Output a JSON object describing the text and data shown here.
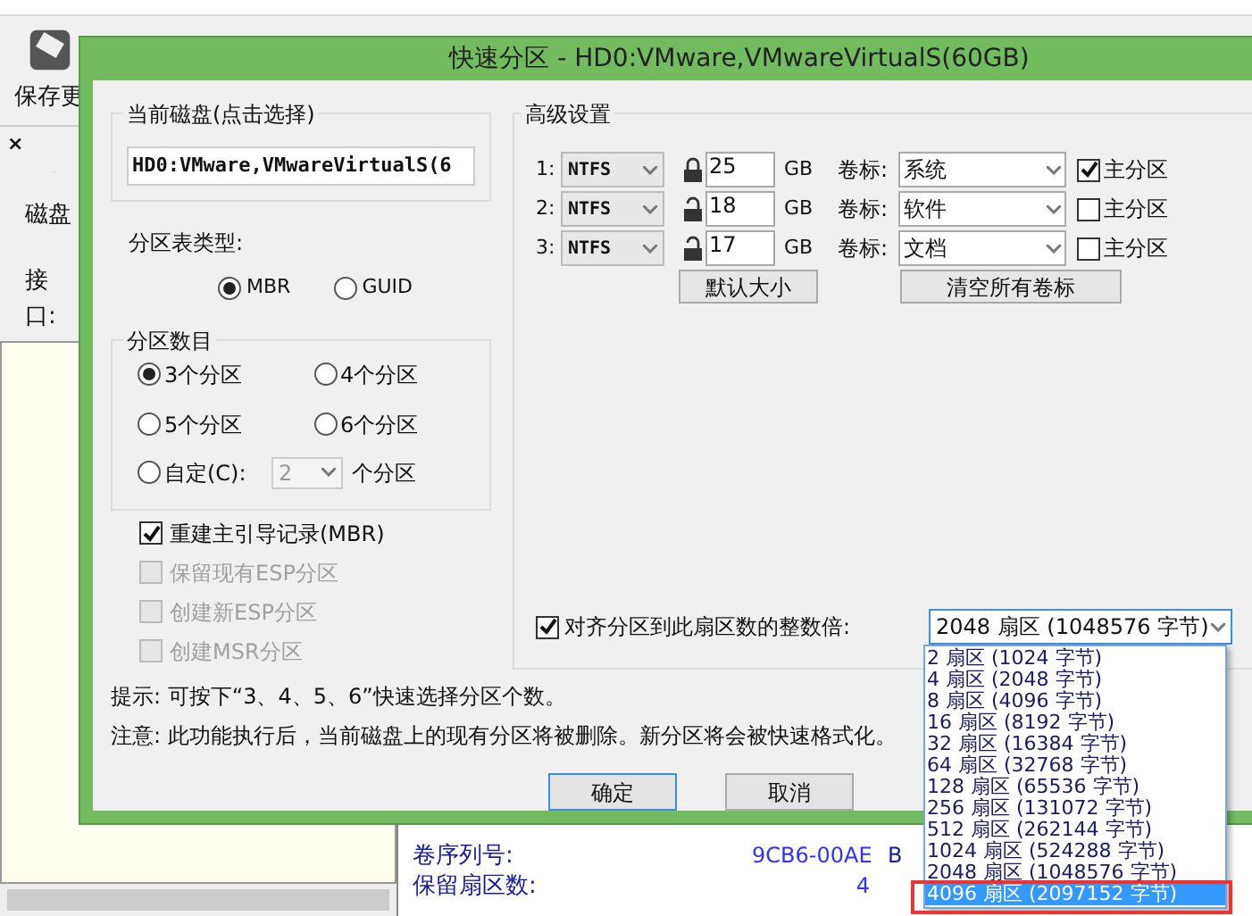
{
  "app": {
    "close": "×",
    "toolbar": [
      "保存更"
    ],
    "side_labels": [
      "磁盘",
      "接口:"
    ],
    "info": [
      {
        "label": "卷序列号:",
        "value": "9CB6-00AE",
        "extra": "B"
      },
      {
        "label": "保留扇区数:",
        "value": "4"
      }
    ]
  },
  "dialog": {
    "title": "快速分区 - HD0:VMware,VMwareVirtualS(60GB)",
    "disk_group": {
      "title": "当前磁盘(点击选择)",
      "value": "HD0:VMware,VMwareVirtualS(6"
    },
    "table_type": {
      "label": "分区表类型:",
      "options": [
        {
          "label": "MBR",
          "selected": true
        },
        {
          "label": "GUID",
          "selected": false
        }
      ]
    },
    "count_group": {
      "title": "分区数目",
      "options": [
        {
          "label": "3个分区",
          "selected": true
        },
        {
          "label": "4个分区",
          "selected": false
        },
        {
          "label": "5个分区",
          "selected": false
        },
        {
          "label": "6个分区",
          "selected": false
        }
      ],
      "custom": {
        "label": "自定(C):",
        "selected": false,
        "value": "2",
        "disabled": true,
        "suffix": "个分区"
      }
    },
    "checks": [
      {
        "label": "重建主引导记录(MBR)",
        "checked": true,
        "disabled": false
      },
      {
        "label": "保留现有ESP分区",
        "checked": false,
        "disabled": true
      },
      {
        "label": "创建新ESP分区",
        "checked": false,
        "disabled": true
      },
      {
        "label": "创建MSR分区",
        "checked": false,
        "disabled": true
      }
    ],
    "advanced": {
      "title": "高级设置",
      "rows": [
        {
          "index": "1:",
          "fs": "NTFS",
          "locked": true,
          "size": "25",
          "unit": "GB",
          "label_caption": "卷标:",
          "volume": "系统",
          "primary_label": "主分区",
          "primary": true
        },
        {
          "index": "2:",
          "fs": "NTFS",
          "locked": false,
          "size": "18",
          "unit": "GB",
          "label_caption": "卷标:",
          "volume": "软件",
          "primary_label": "主分区",
          "primary": false
        },
        {
          "index": "3:",
          "fs": "NTFS",
          "locked": false,
          "size": "17",
          "unit": "GB",
          "label_caption": "卷标:",
          "volume": "文档",
          "primary_label": "主分区",
          "primary": false
        }
      ],
      "buttons": [
        "默认大小",
        "清空所有卷标"
      ],
      "align": {
        "label": "对齐分区到此扇区数的整数倍:",
        "checked": true,
        "value": "2048 扇区 (1048576 字节)",
        "options": [
          {
            "label": "2 扇区 (1024 字节)",
            "highlighted": false
          },
          {
            "label": "4 扇区 (2048 字节)",
            "highlighted": false
          },
          {
            "label": "8 扇区 (4096 字节)",
            "highlighted": false
          },
          {
            "label": "16 扇区 (8192 字节)",
            "highlighted": false
          },
          {
            "label": "32 扇区 (16384 字节)",
            "highlighted": false
          },
          {
            "label": "64 扇区 (32768 字节)",
            "highlighted": false
          },
          {
            "label": "128 扇区 (65536 字节)",
            "highlighted": false
          },
          {
            "label": "256 扇区 (131072 字节)",
            "highlighted": false
          },
          {
            "label": "512 扇区 (262144 字节)",
            "highlighted": false
          },
          {
            "label": "1024 扇区 (524288 字节)",
            "highlighted": false
          },
          {
            "label": "2048 扇区 (1048576 字节)",
            "highlighted": false
          },
          {
            "label": "4096 扇区 (2097152 字节)",
            "highlighted": true
          }
        ]
      }
    },
    "notes": [
      "提示: 可按下“3、4、5、6”快速选择分区个数。",
      "注意: 此功能执行后，当前磁盘上的现有分区将被删除。新分区将会被快速格式化。"
    ],
    "buttons": [
      {
        "label": "确定",
        "default": true
      },
      {
        "label": "取消",
        "default": false
      }
    ]
  }
}
